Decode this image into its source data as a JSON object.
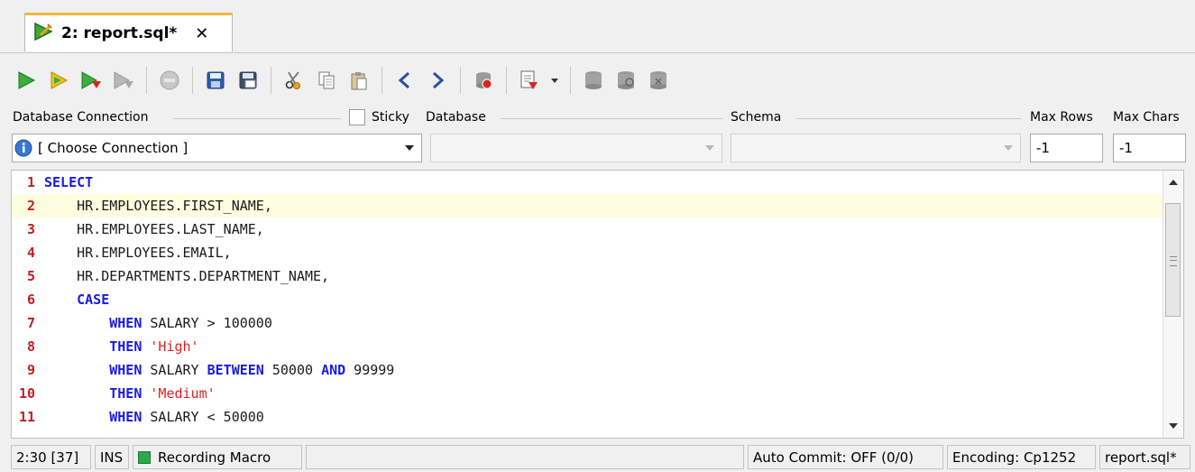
{
  "tab": {
    "title": "2: report.sql*",
    "close": "✕"
  },
  "toolbar": {
    "icons": [
      "execute",
      "execute-current",
      "execute-script",
      "execute-disabled",
      "stop",
      "save",
      "save-as",
      "cut",
      "copy",
      "paste",
      "previous",
      "next",
      "commit",
      "explain",
      "dropdown",
      "db1",
      "db2",
      "db3"
    ]
  },
  "connection": {
    "label_connection": "Database Connection",
    "sticky_label": "Sticky",
    "label_database": "Database",
    "label_schema": "Schema",
    "label_maxrows": "Max Rows",
    "label_maxchars": "Max Chars",
    "connection_value": "[ Choose Connection ]",
    "maxrows_value": "-1",
    "maxchars_value": "-1"
  },
  "editor": {
    "lines": [
      {
        "n": "1",
        "tokens": [
          [
            "kw",
            "SELECT"
          ]
        ]
      },
      {
        "n": "2",
        "tokens": [
          [
            "plain",
            "    HR.EMPLOYEES.FIRST_NAME,"
          ]
        ]
      },
      {
        "n": "3",
        "tokens": [
          [
            "plain",
            "    HR.EMPLOYEES.LAST_NAME,"
          ]
        ]
      },
      {
        "n": "4",
        "tokens": [
          [
            "plain",
            "    HR.EMPLOYEES.EMAIL,"
          ]
        ]
      },
      {
        "n": "5",
        "tokens": [
          [
            "plain",
            "    HR.DEPARTMENTS.DEPARTMENT_NAME,"
          ]
        ]
      },
      {
        "n": "6",
        "tokens": [
          [
            "plain",
            "    "
          ],
          [
            "kw",
            "CASE"
          ]
        ]
      },
      {
        "n": "7",
        "tokens": [
          [
            "plain",
            "        "
          ],
          [
            "kw",
            "WHEN"
          ],
          [
            "plain",
            " SALARY > 100000"
          ]
        ]
      },
      {
        "n": "8",
        "tokens": [
          [
            "plain",
            "        "
          ],
          [
            "kw",
            "THEN"
          ],
          [
            "plain",
            " "
          ],
          [
            "str",
            "'High'"
          ]
        ]
      },
      {
        "n": "9",
        "tokens": [
          [
            "plain",
            "        "
          ],
          [
            "kw",
            "WHEN"
          ],
          [
            "plain",
            " SALARY "
          ],
          [
            "kw",
            "BETWEEN"
          ],
          [
            "plain",
            " 50000 "
          ],
          [
            "kw",
            "AND"
          ],
          [
            "plain",
            " 99999"
          ]
        ]
      },
      {
        "n": "10",
        "tokens": [
          [
            "plain",
            "        "
          ],
          [
            "kw",
            "THEN"
          ],
          [
            "plain",
            " "
          ],
          [
            "str",
            "'Medium'"
          ]
        ]
      },
      {
        "n": "11",
        "tokens": [
          [
            "plain",
            "        "
          ],
          [
            "kw",
            "WHEN"
          ],
          [
            "plain",
            " SALARY < 50000"
          ]
        ]
      }
    ],
    "current_line": 2
  },
  "status": {
    "position": "2:30 [37]",
    "mode": "INS",
    "macro": "Recording Macro",
    "autocommit": "Auto Commit: OFF (0/0)",
    "encoding": "Encoding: Cp1252",
    "file": "report.sql*"
  }
}
